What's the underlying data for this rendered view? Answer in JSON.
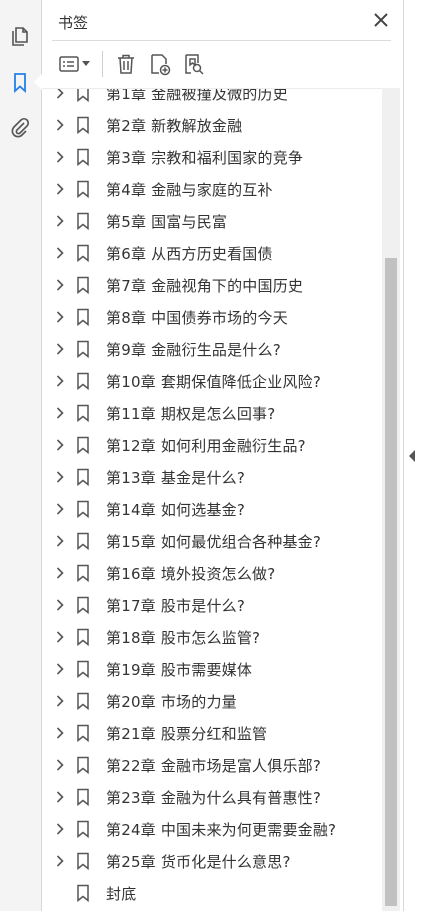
{
  "panel": {
    "title": "书签",
    "close_icon": "close-icon"
  },
  "left_rail": {
    "items": [
      {
        "name": "pages-icon"
      },
      {
        "name": "bookmarks-icon",
        "active": true
      },
      {
        "name": "attachments-icon"
      }
    ]
  },
  "toolbar": {
    "icons": [
      "options-menu-icon",
      "delete-bookmark-icon",
      "new-bookmark-icon",
      "find-bookmark-icon"
    ]
  },
  "bookmarks": [
    {
      "label": "第1章 金融被撞及微的历史",
      "expandable": true
    },
    {
      "label": "第2章 新教解放金融",
      "expandable": true
    },
    {
      "label": "第3章 宗教和福利国家的竞争",
      "expandable": true
    },
    {
      "label": "第4章 金融与家庭的互补",
      "expandable": true
    },
    {
      "label": "第5章 国富与民富",
      "expandable": true
    },
    {
      "label": "第6章 从西方历史看国债",
      "expandable": true
    },
    {
      "label": "第7章 金融视角下的中国历史",
      "expandable": true
    },
    {
      "label": "第8章 中国债券市场的今天",
      "expandable": true
    },
    {
      "label": "第9章 金融衍生品是什么?",
      "expandable": true
    },
    {
      "label": "第10章 套期保值降低企业风险?",
      "expandable": true
    },
    {
      "label": "第11章 期权是怎么回事?",
      "expandable": true
    },
    {
      "label": "第12章 如何利用金融衍生品?",
      "expandable": true
    },
    {
      "label": "第13章 基金是什么?",
      "expandable": true
    },
    {
      "label": "第14章 如何选基金?",
      "expandable": true
    },
    {
      "label": "第15章 如何最优组合各种基金?",
      "expandable": true
    },
    {
      "label": "第16章 境外投资怎么做?",
      "expandable": true
    },
    {
      "label": "第17章 股市是什么?",
      "expandable": true
    },
    {
      "label": "第18章 股市怎么监管?",
      "expandable": true
    },
    {
      "label": "第19章 股市需要媒体",
      "expandable": true
    },
    {
      "label": "第20章 市场的力量",
      "expandable": true
    },
    {
      "label": "第21章 股票分红和监管",
      "expandable": true
    },
    {
      "label": "第22章 金融市场是富人俱乐部?",
      "expandable": true
    },
    {
      "label": "第23章 金融为什么具有普惠性?",
      "expandable": true
    },
    {
      "label": "第24章 中国未来为何更需要金融?",
      "expandable": true
    },
    {
      "label": "第25章 货币化是什么意思?",
      "expandable": true
    },
    {
      "label": "封底",
      "expandable": false
    }
  ],
  "colors": {
    "icon": "#555555",
    "accent": "#2680eb",
    "text": "#333333",
    "scroll_thumb": "#c1c1c1"
  }
}
